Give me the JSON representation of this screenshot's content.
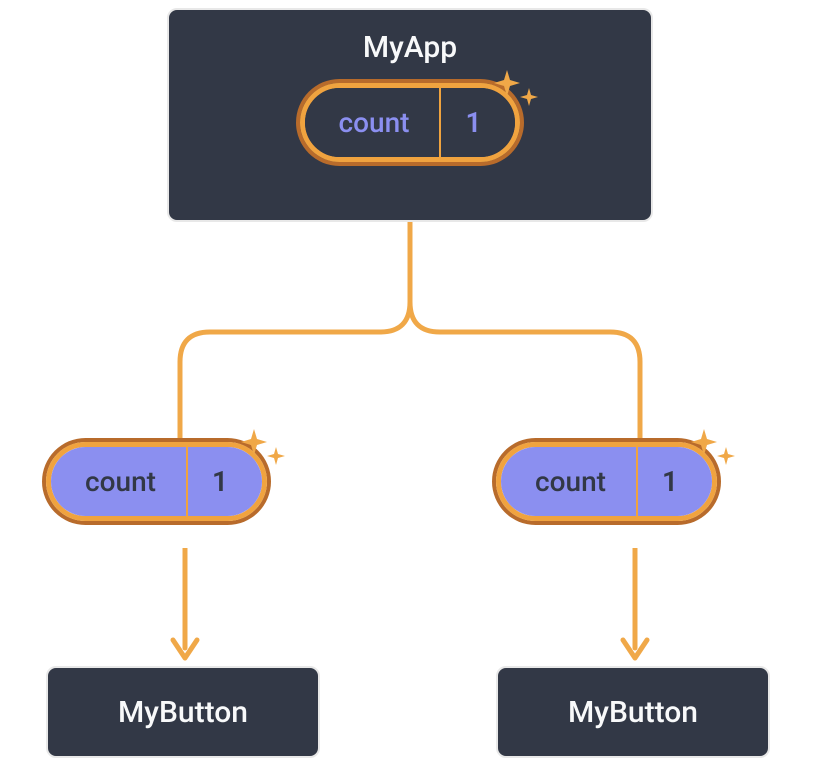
{
  "root": {
    "title": "MyApp",
    "state": {
      "label": "count",
      "value": "1"
    }
  },
  "children": [
    {
      "title": "MyButton",
      "props": {
        "label": "count",
        "value": "1"
      }
    },
    {
      "title": "MyButton",
      "props": {
        "label": "count",
        "value": "1"
      }
    }
  ],
  "colors": {
    "node_bg": "#323846",
    "pill_border_outer": "#b86b2b",
    "pill_border_inner": "#f0a33f",
    "pill_accent": "#8b8ff0",
    "connector": "#f0a848"
  }
}
